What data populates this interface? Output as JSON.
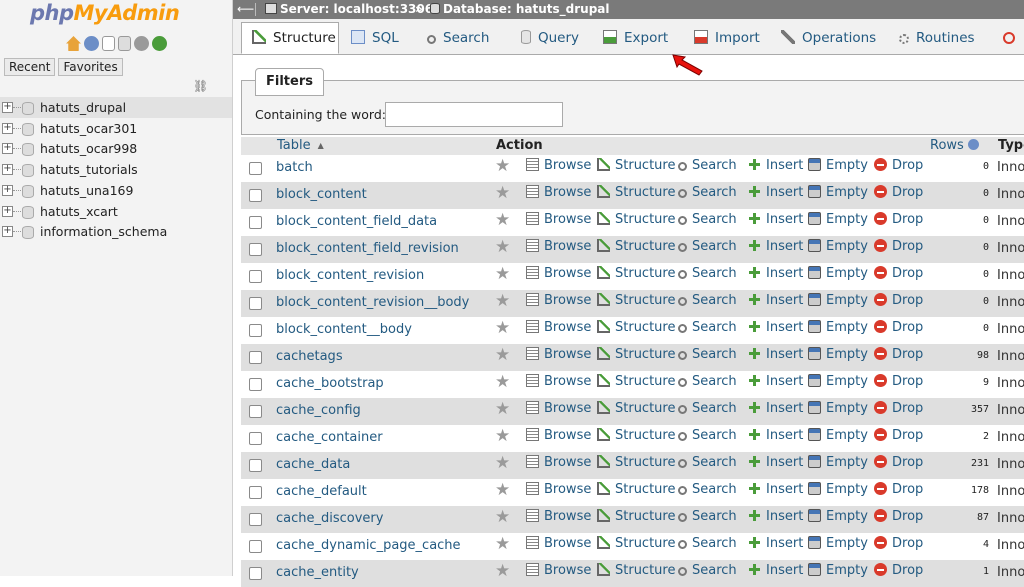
{
  "sidebar": {
    "logo_part1": "php",
    "logo_part2": "MyAdmin",
    "tab_recent": "Recent",
    "tab_favorites": "Favorites",
    "databases": [
      "hatuts_drupal",
      "hatuts_ocar301",
      "hatuts_ocar998",
      "hatuts_tutorials",
      "hatuts_una169",
      "hatuts_xcart",
      "information_schema"
    ],
    "selected": "hatuts_drupal"
  },
  "breadcrumb": {
    "server": "Server: localhost:3306",
    "separator": "»",
    "database": "Database: hatuts_drupal"
  },
  "tabs": [
    "Structure",
    "SQL",
    "Search",
    "Query",
    "Export",
    "Import",
    "Operations",
    "Routines"
  ],
  "active_tab": "Structure",
  "filters": {
    "legend": "Filters",
    "label": "Containing the word:",
    "value": ""
  },
  "table": {
    "headers": {
      "table": "Table",
      "action": "Action",
      "rows": "Rows",
      "type": "Type"
    },
    "actions": {
      "browse": "Browse",
      "structure": "Structure",
      "search": "Search",
      "insert": "Insert",
      "empty": "Empty",
      "drop": "Drop"
    },
    "rows": [
      {
        "name": "batch",
        "rows": "0",
        "type": "InnoDB"
      },
      {
        "name": "block_content",
        "rows": "0",
        "type": "InnoDB"
      },
      {
        "name": "block_content_field_data",
        "rows": "0",
        "type": "InnoDB"
      },
      {
        "name": "block_content_field_revision",
        "rows": "0",
        "type": "InnoDB"
      },
      {
        "name": "block_content_revision",
        "rows": "0",
        "type": "InnoDB"
      },
      {
        "name": "block_content_revision__body",
        "rows": "0",
        "type": "InnoDB"
      },
      {
        "name": "block_content__body",
        "rows": "0",
        "type": "InnoDB"
      },
      {
        "name": "cachetags",
        "rows": "98",
        "type": "InnoDB"
      },
      {
        "name": "cache_bootstrap",
        "rows": "9",
        "type": "InnoDB"
      },
      {
        "name": "cache_config",
        "rows": "357",
        "type": "InnoDB"
      },
      {
        "name": "cache_container",
        "rows": "2",
        "type": "InnoDB"
      },
      {
        "name": "cache_data",
        "rows": "231",
        "type": "InnoDB"
      },
      {
        "name": "cache_default",
        "rows": "178",
        "type": "InnoDB"
      },
      {
        "name": "cache_discovery",
        "rows": "87",
        "type": "InnoDB"
      },
      {
        "name": "cache_dynamic_page_cache",
        "rows": "4",
        "type": "InnoDB"
      },
      {
        "name": "cache_entity",
        "rows": "1",
        "type": "InnoDB"
      }
    ]
  },
  "colors": {
    "link": "#235a81",
    "crumb_bg": "#7a7a7a",
    "row_alt": "#dfdfdf",
    "drop": "#d93a2b",
    "logo_orange": "#f89c0e",
    "logo_blue": "#6c78af"
  }
}
